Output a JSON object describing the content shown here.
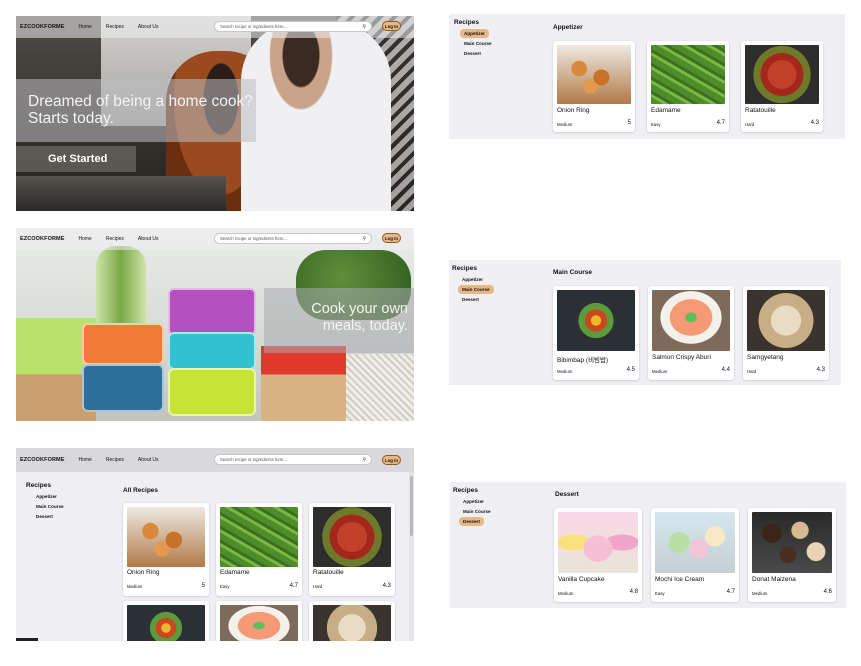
{
  "nav": {
    "brand": "EZCOOKFORME",
    "links": [
      "Home",
      "Recipes",
      "About Us"
    ],
    "search_placeholder": "Search recipe or ingredients here...",
    "login_label": "Log In"
  },
  "hero1": {
    "headline": "Dreamed of being a home cook? Starts today.",
    "cta": "Get Started"
  },
  "hero2": {
    "headline": "Cook your own meals, today."
  },
  "sidebar": {
    "title": "Recipes",
    "items": [
      "Appetizer",
      "Main Course",
      "Dessert"
    ]
  },
  "home": {
    "section_title": "All Recipes"
  },
  "appetizer": {
    "title": "Appetizer",
    "active_index": 0,
    "recipes": [
      {
        "name": "Onion Ring",
        "difficulty": "Medium",
        "rating": "5",
        "image": "onion-ring"
      },
      {
        "name": "Edamame",
        "difficulty": "Easy",
        "rating": "4.7",
        "image": "edamame"
      },
      {
        "name": "Ratatouille",
        "difficulty": "Hard",
        "rating": "4.3",
        "image": "ratatouille"
      }
    ]
  },
  "main_course": {
    "title": "Main Course",
    "active_index": 1,
    "recipes": [
      {
        "name": "Bibimbap (비빔밥)",
        "difficulty": "Medium",
        "rating": "4.5",
        "image": "bibimbap"
      },
      {
        "name": "Salmon Crispy Aburi",
        "difficulty": "Medium",
        "rating": "4.4",
        "image": "salmon-crispy-aburi"
      },
      {
        "name": "Samgyetang",
        "difficulty": "Hard",
        "rating": "4.3",
        "image": "samgyetang"
      }
    ]
  },
  "dessert": {
    "title": "Dessert",
    "active_index": 2,
    "recipes": [
      {
        "name": "Vanilla Cupcake",
        "difficulty": "Medium",
        "rating": "4.8",
        "image": "vanilla-cupcake"
      },
      {
        "name": "Mochi Ice Cream",
        "difficulty": "Easy",
        "rating": "4.7",
        "image": "mochi-ice-cream"
      },
      {
        "name": "Donat Maizena",
        "difficulty": "Medium",
        "rating": "4.6",
        "image": "donat-maizena"
      }
    ]
  },
  "colors": {
    "accent": "#e8b784",
    "panel_bg": "#f0eff3",
    "nav_bg": "#d9d9dc"
  }
}
